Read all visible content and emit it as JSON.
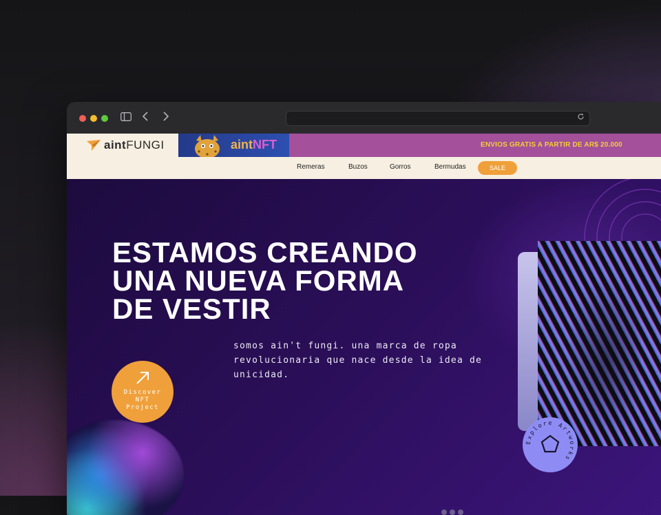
{
  "colors": {
    "accent_orange": "#f0a03a",
    "promo_bg": "#a4509a",
    "promo_text": "#f3cd36",
    "hero_bg": "#2a0e57",
    "explore_bg": "#8e8cf4"
  },
  "browser": {
    "sidebar_icon": "sidebar-toggle-icon",
    "back_icon": "chevron-left-icon",
    "forward_icon": "chevron-right-icon",
    "reload_icon": "reload-icon",
    "address": ""
  },
  "header": {
    "logo_prefix": "aint",
    "logo_suffix": "FUNGI",
    "nft_prefix": "aint",
    "nft_suffix": "NFT",
    "promo": "ENVIOS GRATIS A PARTIR DE AR$ 20.000"
  },
  "nav": {
    "items": [
      "Remeras",
      "Buzos",
      "Gorros",
      "Bermudas"
    ],
    "sale": "SALE"
  },
  "hero": {
    "headline": [
      "ESTAMOS CREANDO",
      "UNA NUEVA FORMA",
      "DE VESTIR"
    ],
    "subtext": "somos ain't fungi. una marca de ropa revolucionaria que nace desde la idea de unicidad.",
    "discover_lines": [
      "Discover",
      "NFT",
      "Project"
    ],
    "explore_label": "Explore Artworks"
  }
}
